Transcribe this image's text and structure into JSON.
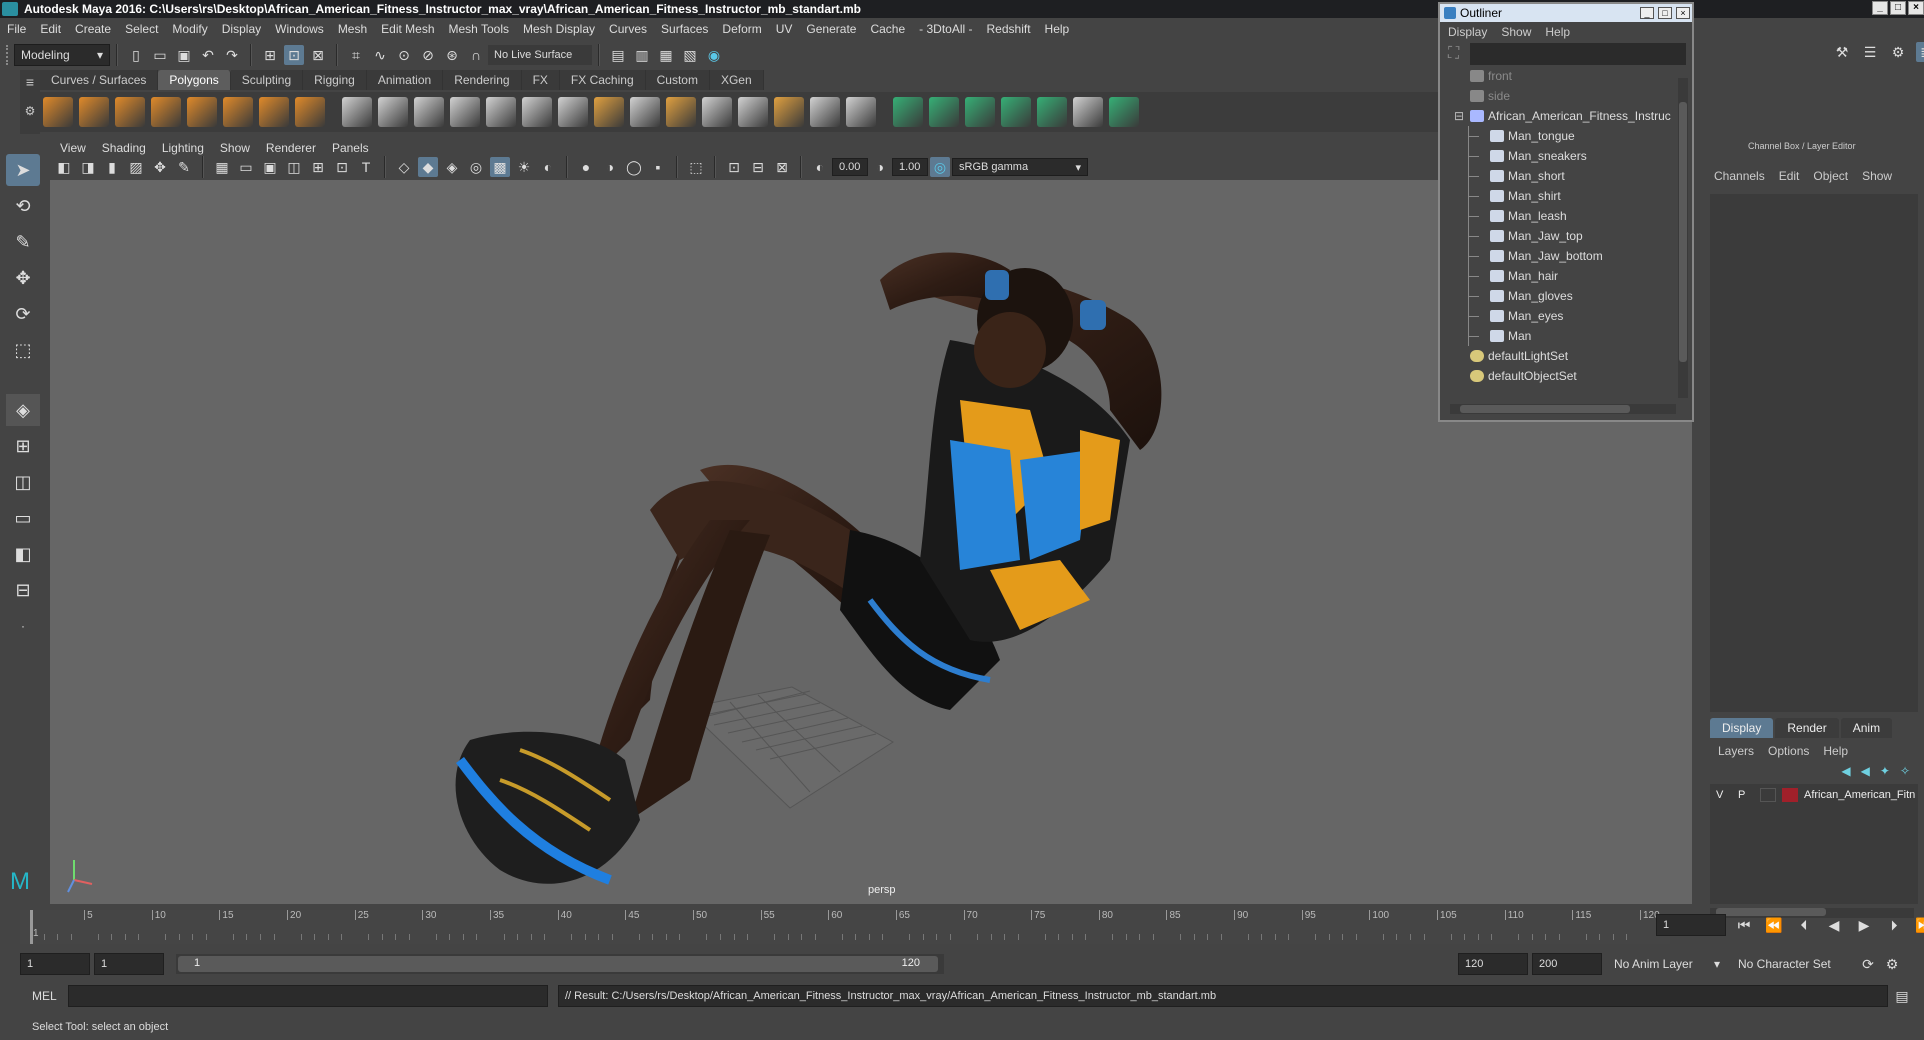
{
  "window": {
    "title": "Autodesk Maya 2016: C:\\Users\\rs\\Desktop\\African_American_Fitness_Instructor_max_vray\\African_American_Fitness_Instructor_mb_standart.mb"
  },
  "menubar": [
    "File",
    "Edit",
    "Create",
    "Select",
    "Modify",
    "Display",
    "Windows",
    "Mesh",
    "Edit Mesh",
    "Mesh Tools",
    "Mesh Display",
    "Curves",
    "Surfaces",
    "Deform",
    "UV",
    "Generate",
    "Cache",
    "- 3DtoAll -",
    "Redshift",
    "Help"
  ],
  "statusline": {
    "mode": "Modeling",
    "live_surface": "No Live Surface"
  },
  "shelf_tabs": [
    "Curves / Surfaces",
    "Polygons",
    "Sculpting",
    "Rigging",
    "Animation",
    "Rendering",
    "FX",
    "FX Caching",
    "Custom",
    "XGen"
  ],
  "shelf_active_tab": "Polygons",
  "viewport": {
    "menu": [
      "View",
      "Shading",
      "Lighting",
      "Show",
      "Renderer",
      "Panels"
    ],
    "exposure": "0.00",
    "gamma": "1.00",
    "color_space": "sRGB gamma",
    "camera_label": "persp"
  },
  "outliner": {
    "title": "Outliner",
    "menu": [
      "Display",
      "Show",
      "Help"
    ],
    "items": [
      {
        "label": "front",
        "depth": 1,
        "type": "camera"
      },
      {
        "label": "side",
        "depth": 1,
        "type": "camera"
      },
      {
        "label": "African_American_Fitness_Instruc",
        "depth": 1,
        "type": "group"
      },
      {
        "label": "Man_tongue",
        "depth": 2,
        "type": "mesh"
      },
      {
        "label": "Man_sneakers",
        "depth": 2,
        "type": "mesh"
      },
      {
        "label": "Man_short",
        "depth": 2,
        "type": "mesh"
      },
      {
        "label": "Man_shirt",
        "depth": 2,
        "type": "mesh"
      },
      {
        "label": "Man_leash",
        "depth": 2,
        "type": "mesh"
      },
      {
        "label": "Man_Jaw_top",
        "depth": 2,
        "type": "mesh"
      },
      {
        "label": "Man_Jaw_bottom",
        "depth": 2,
        "type": "mesh"
      },
      {
        "label": "Man_hair",
        "depth": 2,
        "type": "mesh"
      },
      {
        "label": "Man_gloves",
        "depth": 2,
        "type": "mesh"
      },
      {
        "label": "Man_eyes",
        "depth": 2,
        "type": "mesh"
      },
      {
        "label": "Man",
        "depth": 2,
        "type": "mesh"
      },
      {
        "label": "defaultLightSet",
        "depth": 1,
        "type": "set"
      },
      {
        "label": "defaultObjectSet",
        "depth": 1,
        "type": "set"
      }
    ]
  },
  "channel_box": {
    "title": "Channel Box / Layer Editor",
    "tabs": [
      "Channels",
      "Edit",
      "Object",
      "Show"
    ],
    "layer_tabs": [
      "Display",
      "Render",
      "Anim"
    ],
    "layer_menu": [
      "Layers",
      "Options",
      "Help"
    ],
    "layer": {
      "v": "V",
      "p": "P",
      "name": "African_American_Fitn",
      "color": "#a0202a"
    }
  },
  "timeline": {
    "ticks": [
      "1",
      "5",
      "10",
      "15",
      "20",
      "25",
      "30",
      "35",
      "40",
      "45",
      "50",
      "55",
      "60",
      "65",
      "70",
      "75",
      "80",
      "85",
      "90",
      "95",
      "100",
      "105",
      "110",
      "115",
      "120"
    ],
    "current_frame": "1"
  },
  "range": {
    "start": "1",
    "start_inner": "1",
    "slider_start": "1",
    "slider_end": "120",
    "end_inner": "120",
    "end": "200",
    "anim_layer": "No Anim Layer",
    "character_set": "No Character Set"
  },
  "command": {
    "lang": "MEL",
    "result": "// Result: C:/Users/rs/Desktop/African_American_Fitness_Instructor_max_vray/African_American_Fitness_Instructor_mb_standart.mb"
  },
  "helpline": "Select Tool: select an object",
  "colors": {
    "accent": "#5d7a92",
    "panel": "#444444",
    "viewport": "#666666"
  }
}
